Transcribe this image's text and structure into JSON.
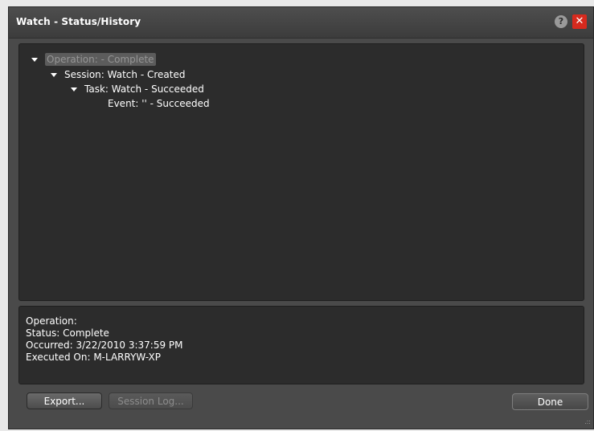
{
  "window": {
    "title": "Watch - Status/History",
    "help_label": "?",
    "close_label": "✕"
  },
  "tree": {
    "operation": "Operation: - Complete",
    "session": "Session:  Watch - Created",
    "task": "Task:  Watch - Succeeded",
    "event": "Event:  '' - Succeeded"
  },
  "details": {
    "operation": "Operation:",
    "status": "Status: Complete",
    "occurred": "Occurred: 3/22/2010 3:37:59 PM",
    "executed_on": "Executed On: M-LARRYW-XP"
  },
  "buttons": {
    "export": "Export...",
    "session_log": "Session Log...",
    "done": "Done"
  },
  "resize_grip": ".::"
}
